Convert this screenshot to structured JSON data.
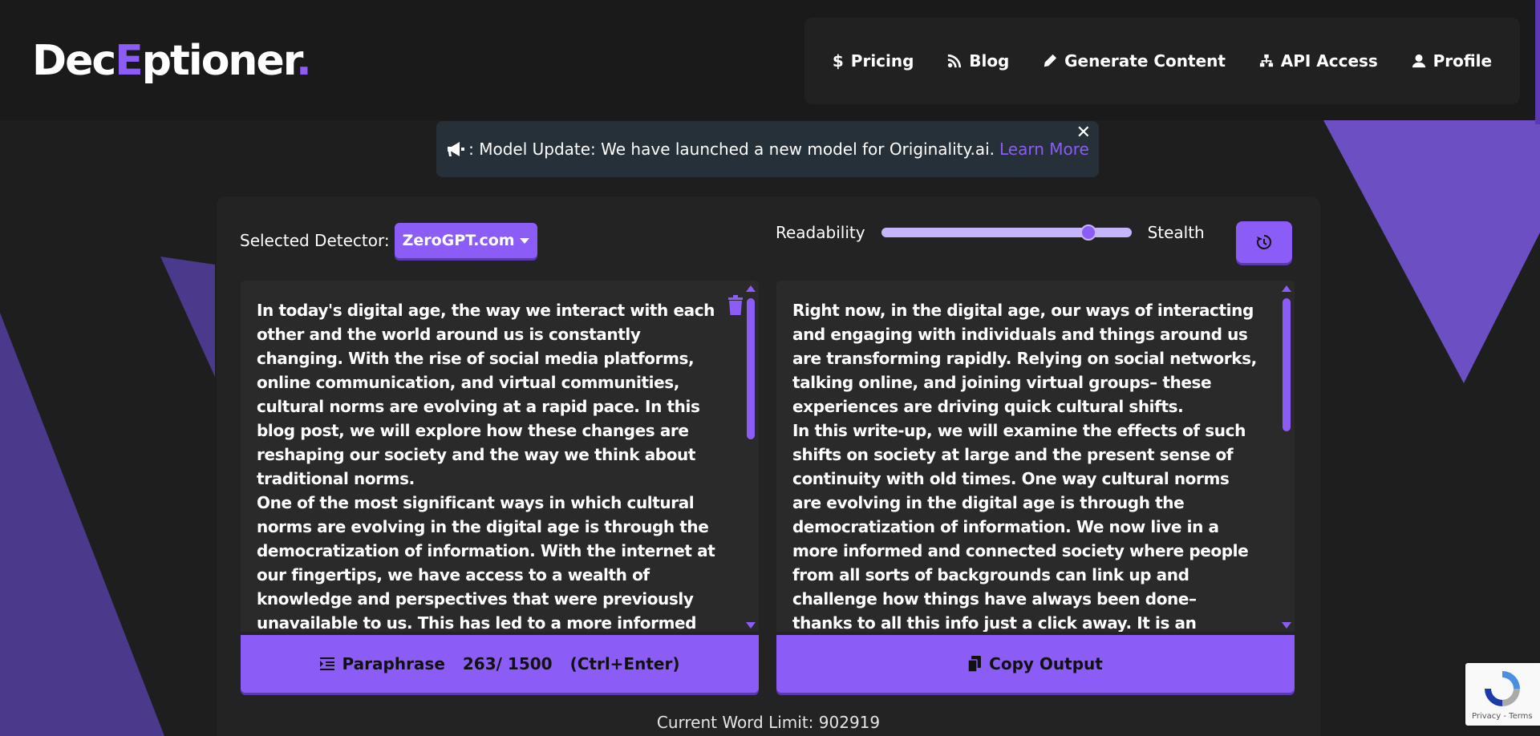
{
  "logo": {
    "part1": "Dec",
    "accent": "E",
    "part2": "ptioner",
    "dot": "."
  },
  "nav": [
    {
      "label": "Pricing",
      "icon": "dollar-icon"
    },
    {
      "label": "Blog",
      "icon": "blog-icon"
    },
    {
      "label": "Generate Content",
      "icon": "pen-icon"
    },
    {
      "label": "API Access",
      "icon": "sitemap-icon"
    },
    {
      "label": "Profile",
      "icon": "user-icon"
    }
  ],
  "banner": {
    "prefix": ": Model Update: We have launched a new model for Originality.ai.",
    "link": "Learn More",
    "close": "✕"
  },
  "controls": {
    "detector_label": "Selected Detector:",
    "detector_value": "ZeroGPT.com",
    "readability_label": "Readability",
    "stealth_label": "Stealth",
    "slider_value": 0.85
  },
  "input_text": "In today's digital age, the way we interact with each other and the world around us is constantly changing. With the rise of social media platforms, online communication, and virtual communities, cultural norms are evolving at a rapid pace. In this blog post, we will explore how these changes are reshaping our society and the way we think about traditional norms.\nOne of the most significant ways in which cultural norms are evolving in the digital age is through the democratization of information. With the internet at our fingertips, we have access to a wealth of knowledge and perspectives that were previously unavailable to us. This has led to a more informed and interconnected society, where individuals from diverse backgrounds can come",
  "output_text": "Right now, in the digital age, our ways of interacting and engaging with individuals and things around us are transforming rapidly. Relying on social networks, talking online, and joining virtual groups– these experiences are driving quick cultural shifts.\nIn this write-up, we will examine the effects of such shifts on society at large and the present sense of continuity with old times. One way cultural norms are evolving in the digital age is through the democratization of information. We now live in a more informed and connected society where people from all sorts of backgrounds can link up and challenge how things have always been done– thanks to all this info just a click away. It is an environment where there is mixing among people of",
  "paraphrase_button": {
    "label": "Paraphrase",
    "count": "263/ 1500",
    "shortcut": "(Ctrl+Enter)"
  },
  "copy_button": {
    "label": "Copy Output"
  },
  "word_limit": "Current Word Limit: 902919",
  "recaptcha": {
    "text": "Privacy - Terms"
  },
  "colors": {
    "accent": "#8b5cf6",
    "background": "#1e1e1e",
    "panel": "#232323"
  }
}
